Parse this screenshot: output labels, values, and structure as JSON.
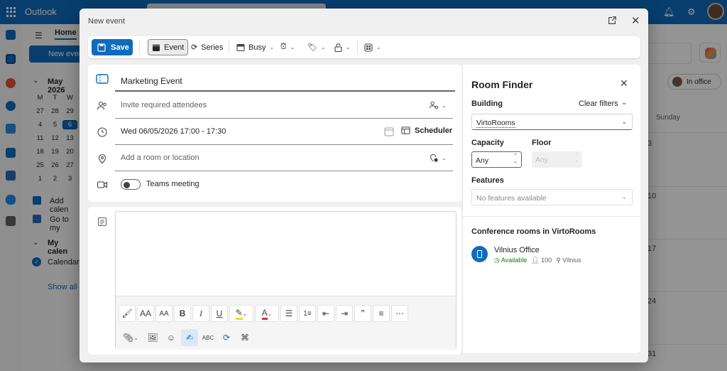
{
  "app": {
    "name": "Outlook"
  },
  "background": {
    "home_tab": "Home",
    "new_event_label": "New event",
    "month_label": "May 2026",
    "weekday_headers": [
      "M",
      "T",
      "W"
    ],
    "mini_calendar": [
      [
        "27",
        "28",
        "29"
      ],
      [
        "4",
        "5",
        "6"
      ],
      [
        "11",
        "12",
        "13"
      ],
      [
        "18",
        "19",
        "20"
      ],
      [
        "25",
        "26",
        "27"
      ],
      [
        "1",
        "2",
        "3"
      ]
    ],
    "add_calendar": "Add calen",
    "go_to_my": "Go to my",
    "my_calendars": "My calen",
    "calendar_name": "Calendar",
    "show_all": "Show all",
    "in_office": "In office",
    "day_header": "Sunday",
    "day_numbers": [
      "3",
      "10",
      "17",
      "24",
      "31"
    ]
  },
  "dialog": {
    "title": "New event",
    "toolbar": {
      "save": "Save",
      "event": "Event",
      "series": "Series",
      "busy": "Busy"
    },
    "form": {
      "title_value": "Marketing Event",
      "attendees_placeholder": "Invite required attendees",
      "datetime": "Wed 06/05/2026 17:00 - 17:30",
      "scheduler": "Scheduler",
      "location_placeholder": "Add a room or location",
      "teams_label": "Teams meeting"
    }
  },
  "room_finder": {
    "title": "Room Finder",
    "building_label": "Building",
    "clear_filters": "Clear filters",
    "building_value": "VirtoRooms",
    "capacity_label": "Capacity",
    "capacity_value": "Any",
    "floor_label": "Floor",
    "floor_value": "Any",
    "features_label": "Features",
    "features_placeholder": "No features available",
    "list_title": "Conference rooms in VirtoRooms",
    "rooms": [
      {
        "name": "Vilnius Office",
        "status": "Available",
        "capacity": "100",
        "location": "Vilnius"
      }
    ]
  },
  "colors": {
    "accent": "#0f6cbd",
    "available": "#107c10"
  }
}
